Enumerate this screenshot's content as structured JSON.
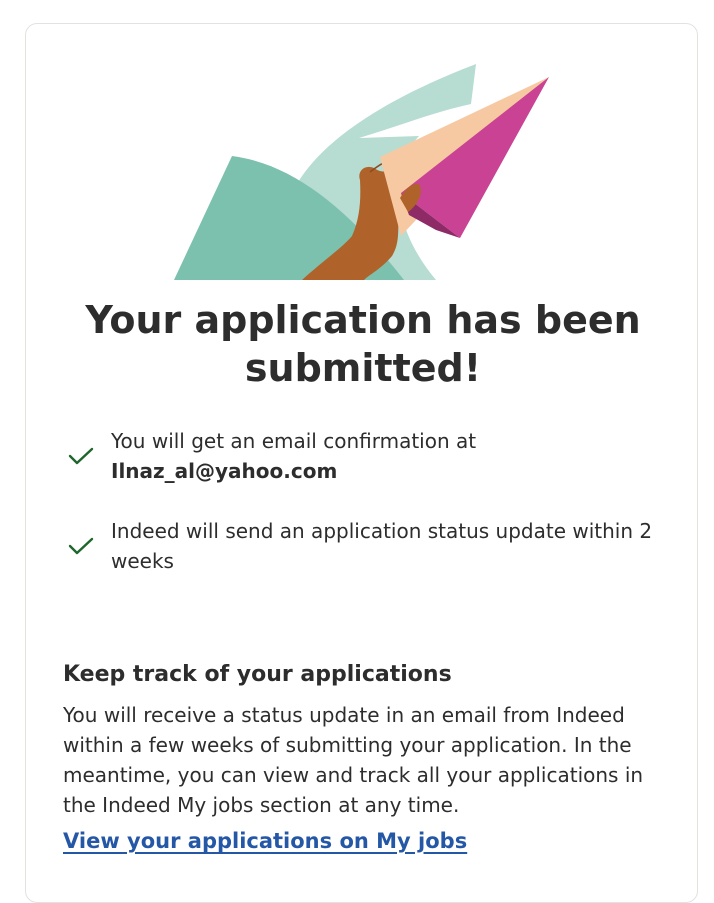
{
  "confirmation": {
    "headline": "Your application has been submitted!",
    "checklist": [
      {
        "text": "You will get an email confirmation at",
        "email": "Ilnaz_al@yahoo.com"
      },
      {
        "text": "Indeed will send an application status update within 2 weeks"
      }
    ]
  },
  "track": {
    "title": "Keep track of your applications",
    "body": "You will receive a status update in an email from Indeed within a few weeks of submitting your application. In the meantime, you can view and track all your applications in the Indeed My jobs section at any time.",
    "link_label": "View your applications on My jobs"
  },
  "icons": {
    "check": "checkmark-icon",
    "illustration": "paper-plane-illustration"
  },
  "colors": {
    "check": "#1f662c",
    "link": "#2557a7",
    "text": "#2d2d2d",
    "teal_dark": "#7cc0ae",
    "teal_light": "#b7dcd2",
    "plane_pink": "#c94294",
    "plane_peach": "#f6c9a3",
    "hand": "#b0622b"
  }
}
